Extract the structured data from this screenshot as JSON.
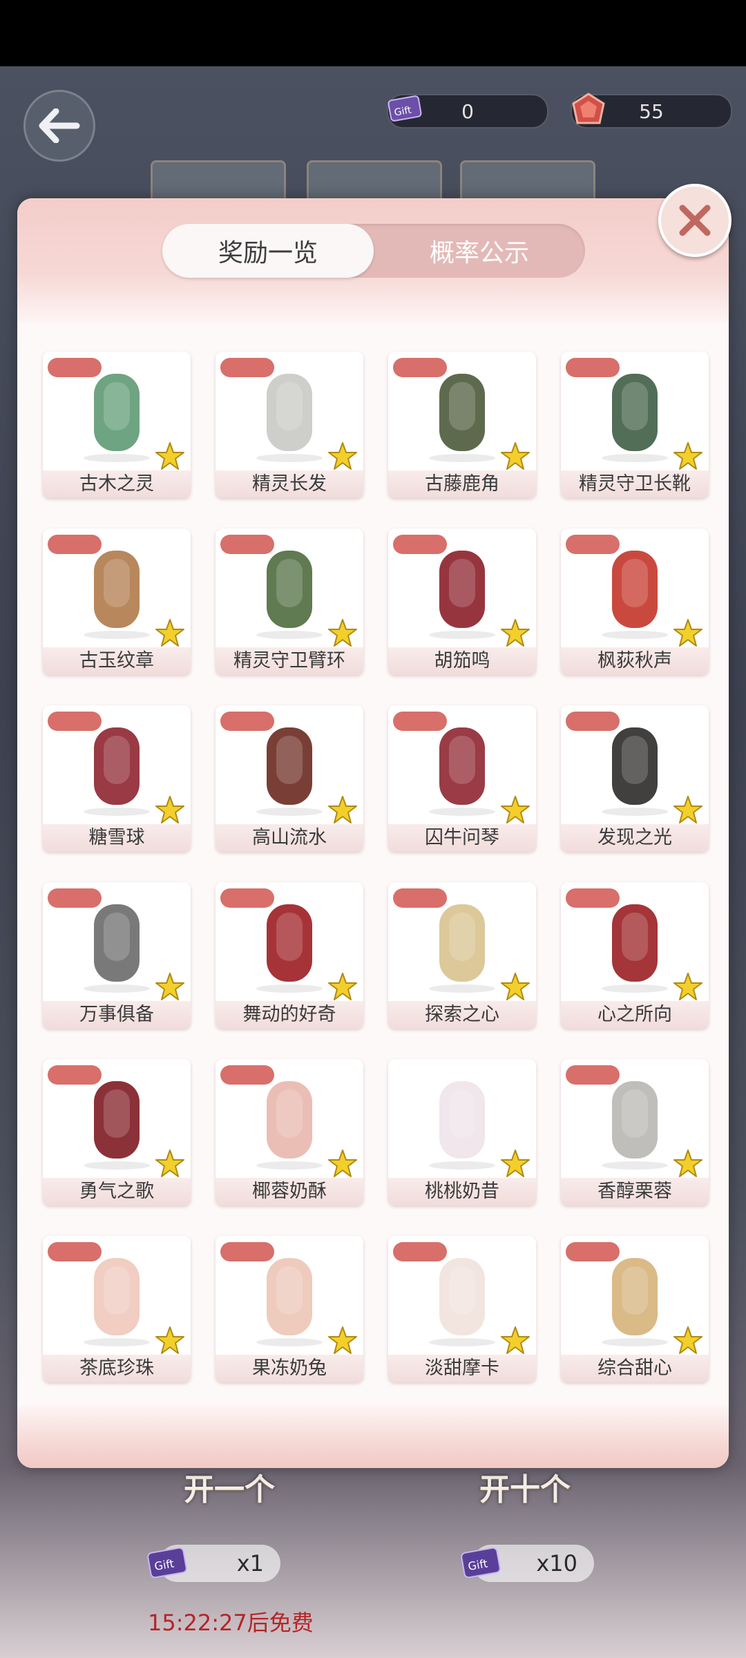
{
  "currency": {
    "ticket_icon": "gift-ticket-icon",
    "ticket_count": "0",
    "crystal_icon": "crystal-icon",
    "crystal_count": "55"
  },
  "modal": {
    "tabs": [
      {
        "label": "奖励一览",
        "active": true
      },
      {
        "label": "概率公示",
        "active": false
      }
    ],
    "items": [
      {
        "name": "古木之灵",
        "icon": "green-outfit-icon",
        "tag": true
      },
      {
        "name": "精灵长发",
        "icon": "silver-hair-icon",
        "tag": true
      },
      {
        "name": "古藤鹿角",
        "icon": "antler-icon",
        "tag": true
      },
      {
        "name": "精灵守卫长靴",
        "icon": "green-boots-icon",
        "tag": true
      },
      {
        "name": "古玉纹章",
        "icon": "jade-earring-icon",
        "tag": true
      },
      {
        "name": "精灵守卫臂环",
        "icon": "armlet-icon",
        "tag": true
      },
      {
        "name": "胡笳鸣",
        "icon": "red-shoes-icon",
        "tag": true
      },
      {
        "name": "枫荻秋声",
        "icon": "red-earring-icon",
        "tag": true
      },
      {
        "name": "糖雪球",
        "icon": "pompom-bow-icon",
        "tag": true
      },
      {
        "name": "高山流水",
        "icon": "brown-hair-icon",
        "tag": true
      },
      {
        "name": "囚牛问琴",
        "icon": "red-dress-icon",
        "tag": true
      },
      {
        "name": "发现之光",
        "icon": "black-boots-icon",
        "tag": true
      },
      {
        "name": "万事俱备",
        "icon": "grey-boots-icon",
        "tag": true
      },
      {
        "name": "舞动的好奇",
        "icon": "ruby-earring-icon",
        "tag": true
      },
      {
        "name": "探索之心",
        "icon": "blonde-bob-icon",
        "tag": true
      },
      {
        "name": "心之所向",
        "icon": "red-hat-icon",
        "tag": true
      },
      {
        "name": "勇气之歌",
        "icon": "red-coat-icon",
        "tag": true
      },
      {
        "name": "椰蓉奶酥",
        "icon": "pink-sandals-icon",
        "tag": true
      },
      {
        "name": "桃桃奶昔",
        "icon": "white-boots-icon",
        "tag": false
      },
      {
        "name": "香醇栗蓉",
        "icon": "braid-hair-icon",
        "tag": true
      },
      {
        "name": "茶底珍珠",
        "icon": "pearl-earring-icon",
        "tag": true
      },
      {
        "name": "果冻奶兔",
        "icon": "bunny-headband-icon",
        "tag": true
      },
      {
        "name": "淡甜摩卡",
        "icon": "cream-dress-icon",
        "tag": true
      },
      {
        "name": "综合甜心",
        "icon": "twin-tail-hair-icon",
        "tag": true
      }
    ]
  },
  "draw": {
    "single_label": "开一个",
    "single_cost": "x1",
    "ten_label": "开十个",
    "ten_cost": "x10",
    "free_timer": "15:22:27后免费"
  },
  "colors": {
    "tag": "#d86f6a",
    "modal_header": "#f4cdca",
    "tab_track": "#e3b9b7",
    "timer_text": "#b52426"
  }
}
